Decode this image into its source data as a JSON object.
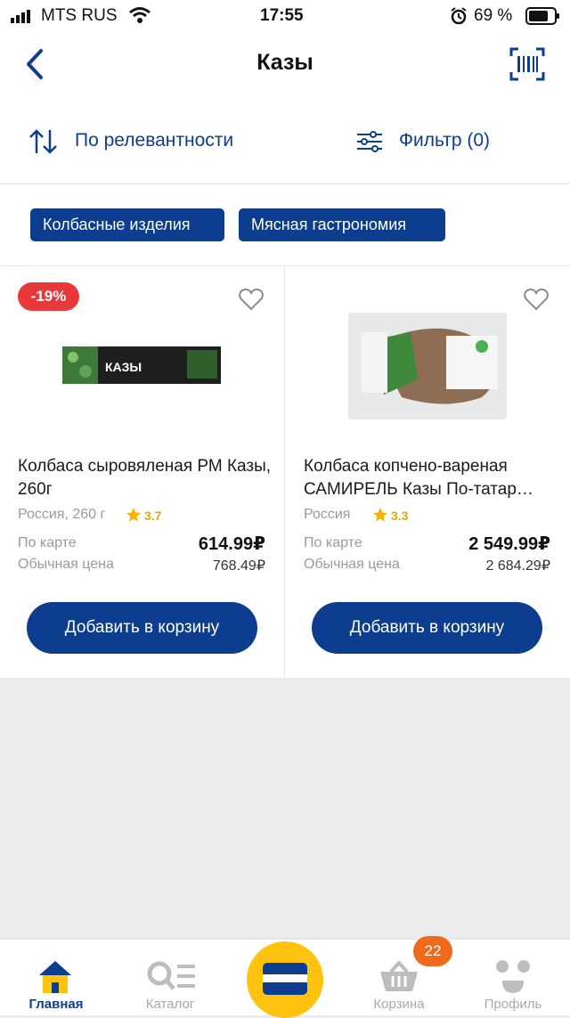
{
  "status": {
    "carrier": "MTS RUS",
    "time": "17:55",
    "battery": "69 %"
  },
  "header": {
    "title": "Казы",
    "back_icon": "chevron-left-icon",
    "scan_icon": "barcode-icon"
  },
  "toolbar": {
    "sort_label": "По релевантности",
    "filter_label": "Фильтр (0)"
  },
  "chips": [
    "Колбасные изделия",
    "Мясная гастрономия"
  ],
  "products": [
    {
      "discount": "-19%",
      "name": "Колбаса сыровяленая РМ Казы, 260г",
      "origin": "Россия, 260 г",
      "rating": "3.7",
      "card_label": "По карте",
      "card_price": "614.99₽",
      "regular_label": "Обычная цена",
      "regular_price": "768.49₽",
      "button": "Добавить в корзину",
      "pack_text": "КАЗЫ"
    },
    {
      "name": "Колбаса копчено-вареная САМИРЕЛЬ Казы По-татар…",
      "origin": "Россия",
      "rating": "3.3",
      "card_label": "По карте",
      "card_price": "2 549.99₽",
      "regular_label": "Обычная цена",
      "regular_price": "2 684.29₽",
      "button": "Добавить в корзину"
    }
  ],
  "tabbar": {
    "items": [
      "Главная",
      "Каталог",
      "Корзина",
      "Профиль"
    ],
    "cart_count": "22"
  },
  "colors": {
    "primary": "#0d3d8f",
    "discount": "#e8393a",
    "cart_badge": "#f06a1b",
    "center_button": "#ffc20e"
  }
}
